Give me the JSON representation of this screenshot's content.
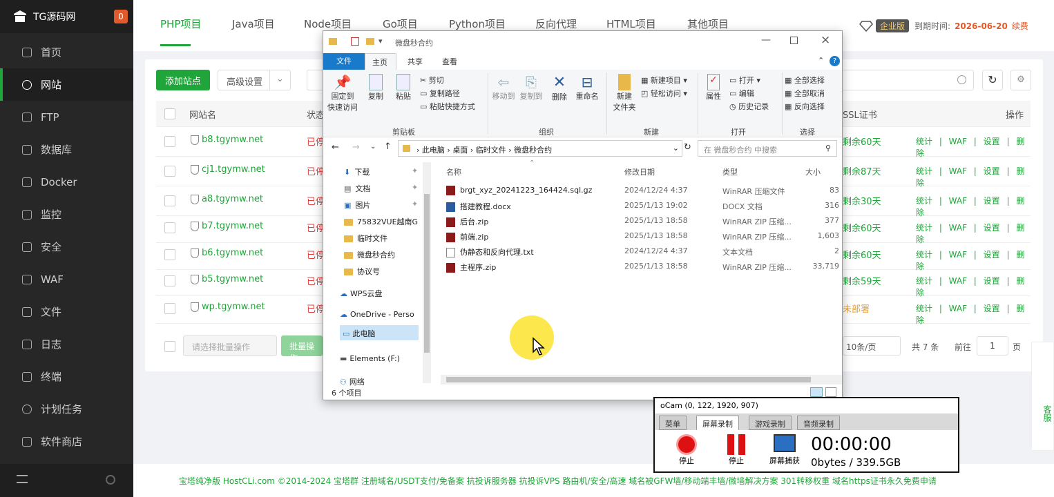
{
  "brand": {
    "name": "TG源码网",
    "badge": "0"
  },
  "sidebar": {
    "items": [
      {
        "label": "首页",
        "icon": "home-icon"
      },
      {
        "label": "网站",
        "icon": "globe-icon"
      },
      {
        "label": "FTP",
        "icon": "ftp-icon"
      },
      {
        "label": "数据库",
        "icon": "database-icon"
      },
      {
        "label": "Docker",
        "icon": "docker-icon"
      },
      {
        "label": "监控",
        "icon": "monitor-icon"
      },
      {
        "label": "安全",
        "icon": "shield-icon"
      },
      {
        "label": "WAF",
        "icon": "waf-icon"
      },
      {
        "label": "文件",
        "icon": "folder-icon"
      },
      {
        "label": "日志",
        "icon": "log-icon"
      },
      {
        "label": "终端",
        "icon": "terminal-icon"
      },
      {
        "label": "计划任务",
        "icon": "clock-icon"
      },
      {
        "label": "软件商店",
        "icon": "store-icon"
      }
    ]
  },
  "topbar": {
    "tabs": [
      "PHP项目",
      "Java项目",
      "Node项目",
      "Go项目",
      "Python项目",
      "反向代理",
      "HTML项目",
      "其他项目"
    ],
    "edition": "企业版",
    "expire_label": "到期时间:",
    "expire_date": "2026-06-20",
    "renew": "续费"
  },
  "toolbar": {
    "add_site": "添加站点",
    "advanced": "高级设置"
  },
  "table": {
    "headers": {
      "site": "网站名",
      "status": "状态",
      "ssl": "SSL证书",
      "ops": "操作"
    },
    "rows": [
      {
        "site": "b8.tgymw.net",
        "status": "已停",
        "ssl": "剩余60天"
      },
      {
        "site": "cj1.tgymw.net",
        "status": "已停",
        "ssl": "剩余87天"
      },
      {
        "site": "a8.tgymw.net",
        "status": "已停",
        "ssl": "剩余30天"
      },
      {
        "site": "b7.tgymw.net",
        "status": "已停",
        "ssl": "剩余60天"
      },
      {
        "site": "b6.tgymw.net",
        "status": "已停",
        "ssl": "剩余60天"
      },
      {
        "site": "b5.tgymw.net",
        "status": "已停",
        "ssl": "剩余59天"
      },
      {
        "site": "wp.tgymw.net",
        "status": "已停",
        "ssl": "未部署"
      }
    ],
    "ops": "统计 | WAF | 设置 | 删除",
    "batch_placeholder": "请选择批量操作",
    "batch_btn": "批量操作",
    "per_page": "10条/页",
    "total": "共 7 条",
    "goto": "前往",
    "page": "1",
    "page_unit": "页"
  },
  "footer": {
    "text": "宝塔纯净版 HostCLi.com ©2014-2024    宝塔群   注册域名/USDT支付/免备案   抗投诉服务器   抗投诉VPS   路由机/安全/高速   域名被GFW墙/移动端丰墙/微墙解决方案   301转移权重   域名https证书永久免费申请"
  },
  "chat": {
    "label": "客服"
  },
  "explorer": {
    "title": "微盘秒合约",
    "ribbon_tabs": [
      "文件",
      "主页",
      "共享",
      "查看"
    ],
    "clipboard": {
      "pin": "固定到\n快速访问",
      "copy": "复制",
      "paste": "粘贴",
      "cut": "剪切",
      "copy_path": "复制路径",
      "paste_shortcut": "粘贴快捷方式",
      "group": "剪贴板"
    },
    "organize": {
      "move": "移动到",
      "copy_to": "复制到",
      "delete": "删除",
      "rename": "重命名",
      "group": "组织"
    },
    "new": {
      "new_folder": "新建\n文件夹",
      "new_item": "新建项目",
      "easy_access": "轻松访问",
      "group": "新建"
    },
    "open": {
      "props": "属性",
      "open": "打开",
      "edit": "编辑",
      "history": "历史记录",
      "group": "打开"
    },
    "select": {
      "all": "全部选择",
      "none": "全部取消",
      "invert": "反向选择",
      "group": "选择"
    },
    "breadcrumb": [
      "此电脑",
      "桌面",
      "临时文件",
      "微盘秒合约"
    ],
    "search_placeholder": "在 微盘秒合约 中搜索",
    "nav": [
      {
        "label": "下载",
        "pinned": true
      },
      {
        "label": "文档",
        "pinned": true
      },
      {
        "label": "图片",
        "pinned": true
      },
      {
        "label": "75832VUE越南G",
        "pinned": false
      },
      {
        "label": "临时文件",
        "pinned": false
      },
      {
        "label": "微盘秒合约",
        "pinned": false
      },
      {
        "label": "协议号",
        "pinned": false
      },
      {
        "label": "WPS云盘",
        "pinned": false
      },
      {
        "label": "OneDrive - Perso",
        "pinned": false
      },
      {
        "label": "此电脑",
        "pinned": false
      },
      {
        "label": "Elements (F:)",
        "pinned": false
      },
      {
        "label": "网络",
        "pinned": false
      }
    ],
    "columns": [
      "名称",
      "修改日期",
      "类型",
      "大小"
    ],
    "files": [
      {
        "name": "brgt_xyz_20241223_164424.sql.gz",
        "date": "2024/12/24 4:37",
        "type": "WinRAR 压缩文件",
        "size": "83"
      },
      {
        "name": "搭建教程.docx",
        "date": "2025/1/13 19:02",
        "type": "DOCX 文档",
        "size": "316"
      },
      {
        "name": "后台.zip",
        "date": "2025/1/13 18:58",
        "type": "WinRAR ZIP 压缩...",
        "size": "377"
      },
      {
        "name": "前端.zip",
        "date": "2025/1/13 18:58",
        "type": "WinRAR ZIP 压缩...",
        "size": "1,603"
      },
      {
        "name": "伪静态和反向代理.txt",
        "date": "2024/12/24 4:37",
        "type": "文本文档",
        "size": "2"
      },
      {
        "name": "主程序.zip",
        "date": "2025/1/13 18:58",
        "type": "WinRAR ZIP 压缩...",
        "size": "33,719"
      }
    ],
    "status": "6 个项目"
  },
  "ocam": {
    "title": "oCam (0, 122, 1920, 907)",
    "tabs": [
      "菜单",
      "屏幕录制",
      "游戏录制",
      "音频录制"
    ],
    "stop1": "停止",
    "stop2": "停止",
    "capture": "屏幕捕获",
    "timer": "00:00:00",
    "storage": "0bytes / 339.5GB"
  }
}
